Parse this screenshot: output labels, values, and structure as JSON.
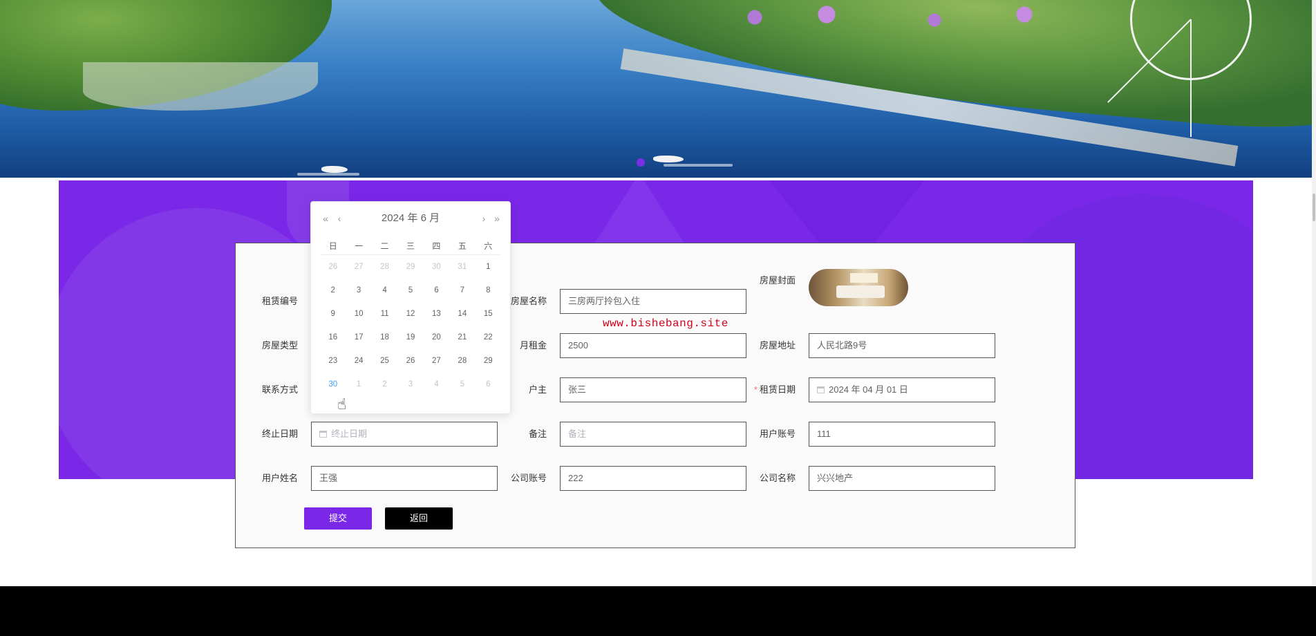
{
  "watermark": "www.bishebang.site",
  "form": {
    "fields": [
      {
        "label": "租赁编号",
        "value": "",
        "placeholder": ""
      },
      {
        "label": "房屋名称",
        "value": "三房两厅拎包入住"
      },
      {
        "label": "房屋封面"
      },
      {
        "label": "房屋类型",
        "value": ""
      },
      {
        "label": "月租金",
        "value": "2500"
      },
      {
        "label": "房屋地址",
        "value": "人民北路9号"
      },
      {
        "label": "联系方式",
        "value": ""
      },
      {
        "label": "户主",
        "value": "张三"
      },
      {
        "label": "租赁日期",
        "required_mark": "*",
        "value": "2024 年 04 月 01 日"
      },
      {
        "label": "终止日期",
        "placeholder": "终止日期"
      },
      {
        "label": "备注",
        "placeholder": "备注"
      },
      {
        "label": "用户账号",
        "value": "111"
      },
      {
        "label": "用户姓名",
        "value": "王强"
      },
      {
        "label": "公司账号",
        "value": "222"
      },
      {
        "label": "公司名称",
        "value": "兴兴地产"
      }
    ],
    "buttons": {
      "submit": "提交",
      "back": "返回"
    }
  },
  "datepicker": {
    "title": "2024 年  6 月",
    "nav": {
      "prev_year": "«",
      "prev_month": "‹",
      "next_month": "›",
      "next_year": "»"
    },
    "weekdays": [
      "日",
      "一",
      "二",
      "三",
      "四",
      "五",
      "六"
    ],
    "weeks": [
      [
        {
          "d": "26",
          "t": "other"
        },
        {
          "d": "27",
          "t": "other"
        },
        {
          "d": "28",
          "t": "other"
        },
        {
          "d": "29",
          "t": "other"
        },
        {
          "d": "30",
          "t": "other"
        },
        {
          "d": "31",
          "t": "other"
        },
        {
          "d": "1",
          "t": "cur"
        }
      ],
      [
        {
          "d": "2",
          "t": "cur"
        },
        {
          "d": "3",
          "t": "cur"
        },
        {
          "d": "4",
          "t": "cur"
        },
        {
          "d": "5",
          "t": "cur"
        },
        {
          "d": "6",
          "t": "cur"
        },
        {
          "d": "7",
          "t": "cur"
        },
        {
          "d": "8",
          "t": "cur"
        }
      ],
      [
        {
          "d": "9",
          "t": "cur"
        },
        {
          "d": "10",
          "t": "cur"
        },
        {
          "d": "11",
          "t": "cur"
        },
        {
          "d": "12",
          "t": "cur"
        },
        {
          "d": "13",
          "t": "cur"
        },
        {
          "d": "14",
          "t": "cur"
        },
        {
          "d": "15",
          "t": "cur"
        }
      ],
      [
        {
          "d": "16",
          "t": "cur"
        },
        {
          "d": "17",
          "t": "cur"
        },
        {
          "d": "18",
          "t": "cur"
        },
        {
          "d": "19",
          "t": "cur"
        },
        {
          "d": "20",
          "t": "cur"
        },
        {
          "d": "21",
          "t": "cur"
        },
        {
          "d": "22",
          "t": "cur"
        }
      ],
      [
        {
          "d": "23",
          "t": "cur"
        },
        {
          "d": "24",
          "t": "cur"
        },
        {
          "d": "25",
          "t": "cur"
        },
        {
          "d": "26",
          "t": "cur"
        },
        {
          "d": "27",
          "t": "cur"
        },
        {
          "d": "28",
          "t": "cur"
        },
        {
          "d": "29",
          "t": "cur"
        }
      ],
      [
        {
          "d": "30",
          "t": "today"
        },
        {
          "d": "1",
          "t": "other"
        },
        {
          "d": "2",
          "t": "other"
        },
        {
          "d": "3",
          "t": "other"
        },
        {
          "d": "4",
          "t": "other"
        },
        {
          "d": "5",
          "t": "other"
        },
        {
          "d": "6",
          "t": "other"
        }
      ]
    ]
  },
  "icons": {
    "calendar": "calendar-icon",
    "cursor": "hand-pointer-icon",
    "carousel_dot": "carousel-dot-icon"
  },
  "colors": {
    "accent": "#7b27e8",
    "back_button": "#000000",
    "watermark": "#d0021b",
    "today": "#409eff",
    "required": "#f56c6c"
  }
}
